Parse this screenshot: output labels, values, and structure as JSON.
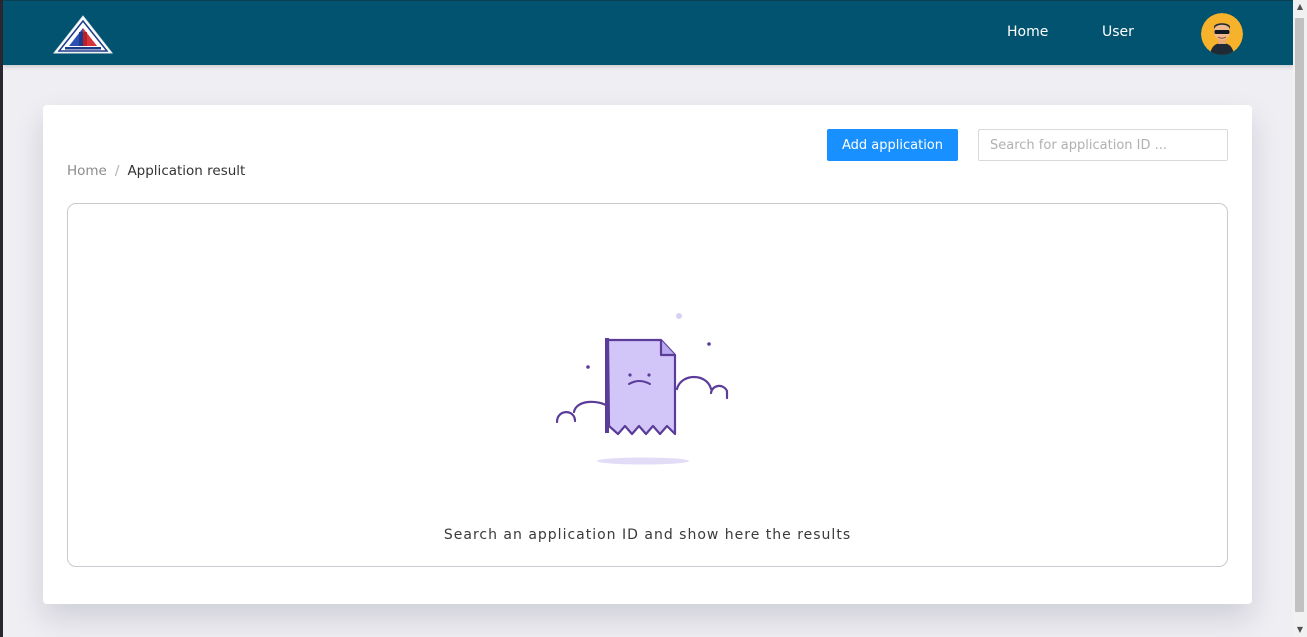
{
  "header": {
    "logo_icon": "agency-triangle-logo",
    "nav_home_label": "Home",
    "nav_user_label": "User",
    "avatar_icon": "user-avatar-sunglasses"
  },
  "toolbar": {
    "add_label": "Add application",
    "search_placeholder": "Search for application ID ..."
  },
  "breadcrumb": {
    "home": "Home",
    "separator": "/",
    "current": "Application result"
  },
  "empty_state": {
    "icon": "sad-document-icon",
    "message": "Search an application ID and show here the results"
  },
  "colors": {
    "navbar": "#01536f",
    "primary_button": "#1890ff",
    "page_background": "#eeeef3",
    "illustration_fill": "#d2c6f9",
    "illustration_stroke": "#5b3c99"
  }
}
